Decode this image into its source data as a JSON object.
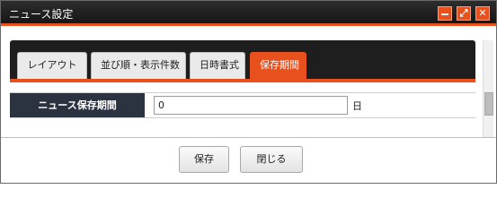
{
  "window": {
    "title": "ニュース設定",
    "accent_color": "#e8501e",
    "controls": {
      "minimize_icon": "minimize-icon",
      "maximize_icon": "expand-icon",
      "close_icon": "close-icon",
      "maximize_glyph": "⤢",
      "close_glyph": "✕"
    }
  },
  "tabs": [
    {
      "label": "レイアウト",
      "active": false
    },
    {
      "label": "並び順・表示件数",
      "active": false
    },
    {
      "label": "日時書式",
      "active": false
    },
    {
      "label": "保存期間",
      "active": true
    }
  ],
  "form": {
    "label": "ニュース保存期間",
    "value": "0",
    "unit": "日"
  },
  "footer": {
    "save_label": "保存",
    "close_label": "閉じる"
  }
}
